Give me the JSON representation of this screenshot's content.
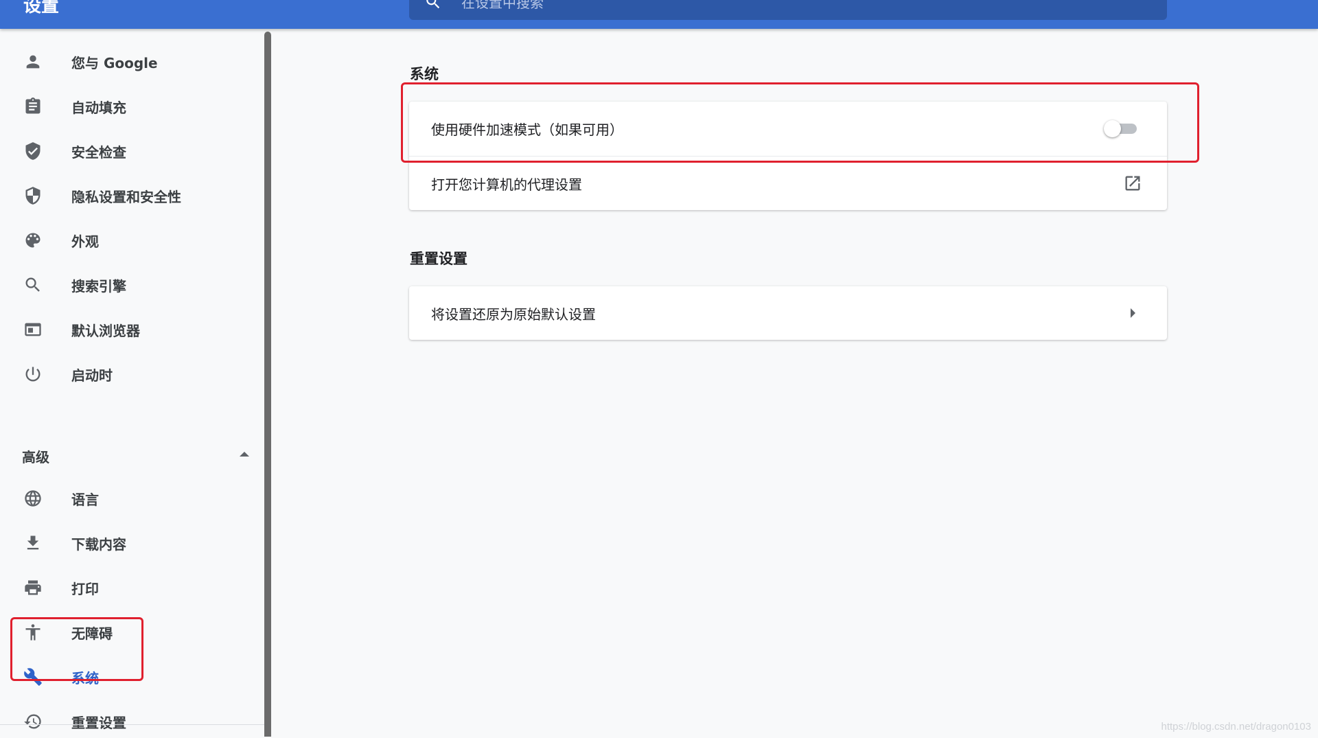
{
  "header": {
    "title": "设置",
    "search_placeholder": "在设置中搜索"
  },
  "sidebar": {
    "items": [
      {
        "label": "您与 Google",
        "icon": "person-icon"
      },
      {
        "label": "自动填充",
        "icon": "clipboard-icon"
      },
      {
        "label": "安全检查",
        "icon": "shield-check-icon"
      },
      {
        "label": "隐私设置和安全性",
        "icon": "shield-half-icon"
      },
      {
        "label": "外观",
        "icon": "palette-icon"
      },
      {
        "label": "搜索引擎",
        "icon": "search-icon"
      },
      {
        "label": "默认浏览器",
        "icon": "browser-window-icon"
      },
      {
        "label": "启动时",
        "icon": "power-icon"
      }
    ],
    "advanced_label": "高级",
    "advanced_items": [
      {
        "label": "语言",
        "icon": "globe-icon"
      },
      {
        "label": "下载内容",
        "icon": "download-icon"
      },
      {
        "label": "打印",
        "icon": "printer-icon"
      },
      {
        "label": "无障碍",
        "icon": "accessibility-icon"
      },
      {
        "label": "系统",
        "icon": "wrench-icon",
        "active": true
      },
      {
        "label": "重置设置",
        "icon": "history-icon"
      }
    ]
  },
  "main": {
    "system_section": {
      "title": "系统",
      "rows": [
        {
          "label": "使用硬件加速模式（如果可用）",
          "control": "toggle",
          "enabled": false
        },
        {
          "label": "打开您计算机的代理设置",
          "control": "open-in-new"
        }
      ]
    },
    "reset_section": {
      "title": "重置设置",
      "rows": [
        {
          "label": "将设置还原为原始默认设置",
          "control": "chevron-right"
        }
      ]
    }
  },
  "colors": {
    "header_bg": "#3a6fd1",
    "accent": "#2f63c9",
    "highlight_box": "#e0202e"
  },
  "watermark": "https://blog.csdn.net/dragon0103"
}
